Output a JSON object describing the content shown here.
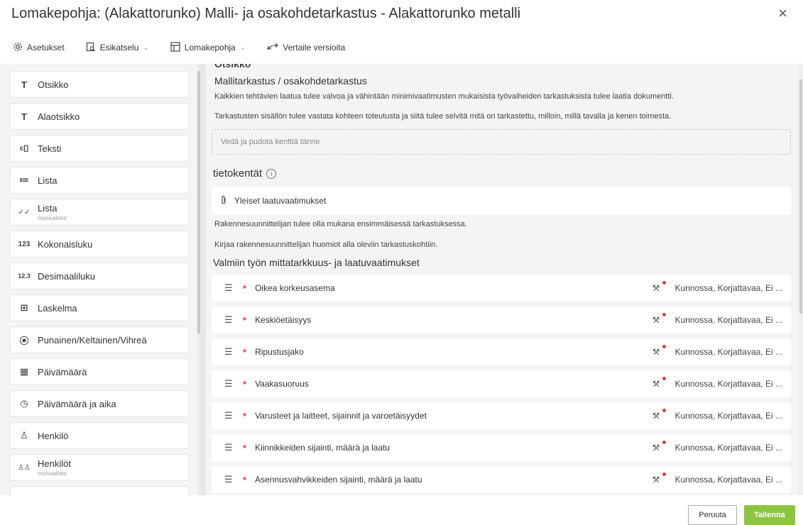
{
  "header": {
    "title": "Lomakepohja: (Alakattorunko) Malli- ja osakohdetarkastus - Alakattorunko metalli",
    "close_label": "×"
  },
  "toolbar": {
    "settings_label": "Asetukset",
    "preview_label": "Esikatselu",
    "template_label": "Lomakepohja",
    "compare_label": "Vertaile versioita"
  },
  "palette": [
    {
      "icon": "T",
      "label": "Otsikko",
      "sub": ""
    },
    {
      "icon": "T",
      "label": "Alaotsikko",
      "sub": ""
    },
    {
      "icon": "c[]",
      "label": "Teksti",
      "sub": ""
    },
    {
      "icon": "≔",
      "label": "Lista",
      "sub": ""
    },
    {
      "icon": "✓✓",
      "label": "Lista",
      "sub": "monivalinta"
    },
    {
      "icon": "123",
      "label": "Kokonaisluku",
      "sub": ""
    },
    {
      "icon": "12.3",
      "label": "Desimaaliluku",
      "sub": ""
    },
    {
      "icon": "⊞",
      "label": "Laskelma",
      "sub": ""
    },
    {
      "icon": "⦿",
      "label": "Punainen/Keltainen/Vihreä",
      "sub": ""
    },
    {
      "icon": "▦",
      "label": "Päivämäärä",
      "sub": ""
    },
    {
      "icon": "◷",
      "label": "Päivämäärä ja aika",
      "sub": ""
    },
    {
      "icon": "♙",
      "label": "Henkilö",
      "sub": ""
    },
    {
      "icon": "♙♙",
      "label": "Henkilöt",
      "sub": "monivalinta"
    }
  ],
  "main": {
    "partial_heading": "Otsikko",
    "section1": {
      "title": "Mallitarkastus / osakohdetarkastus",
      "desc1": "Kaikkien tehtävien laatua tulee valvoa ja vähintään minimivaatimusten mukaisista työvaiheiden tarkastuksista tulee laatia dokumentti.",
      "desc2": "Tarkastusten sisällön tulee vastata kohteen toteutusta ja siitä tulee selvitä mitä on tarkastettu, milloin, millä tavalla ja kenen toimesta.",
      "dropzone": "Vedä ja pudota kenttiä tänne"
    },
    "section2": {
      "title": "tietokentät",
      "attachment": "Yleiset laatuvaatimukset",
      "note1": "Rakennesuunnittelijan tulee olla mukana ensimmäisessä tarkastuksessa.",
      "note2": "Kirjaa rakennesuunnittelijan huomiot alla oleviin tarkastuskohtiin."
    },
    "section3": {
      "title": "Valmiin työn mittatarkkuus- ja laatuvaatimukset",
      "options_text": "Kunnossa, Korjattavaa, Ei ...",
      "rows": [
        "Oikea korkeusasema",
        "Keskiöetäisyys",
        "Ripustusjako",
        "Vaakasuoruus",
        "Varusteet ja laitteet, sijainnit ja varoetäisyydet",
        "Kiinnikkeiden sijainti, määrä ja laatu",
        "Asennusvahvikkeiden sijainti, määrä ja laatu"
      ]
    }
  },
  "footer": {
    "cancel_label": "Peruuta",
    "save_label": "Tallenna"
  },
  "colors": {
    "accent_green": "#8cc63f",
    "required_red": "#e23b3b",
    "panel_bg": "#f4f4f4"
  }
}
